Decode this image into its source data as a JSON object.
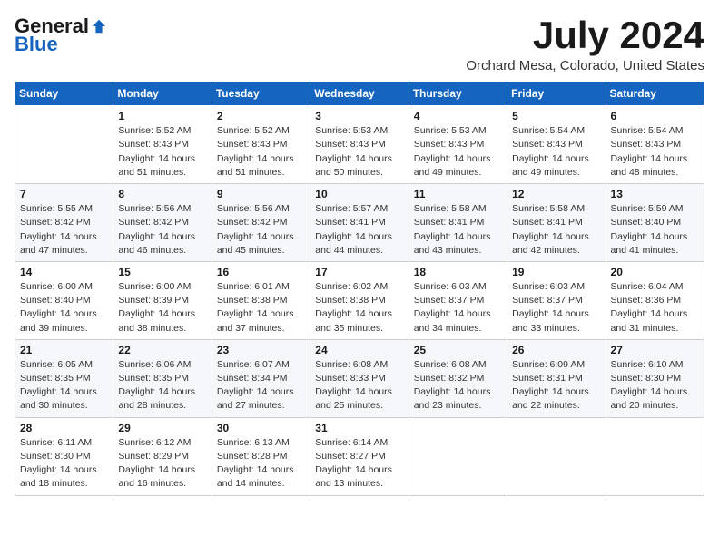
{
  "logo": {
    "general": "General",
    "blue": "Blue"
  },
  "title": {
    "month": "July 2024",
    "location": "Orchard Mesa, Colorado, United States"
  },
  "headers": [
    "Sunday",
    "Monday",
    "Tuesday",
    "Wednesday",
    "Thursday",
    "Friday",
    "Saturday"
  ],
  "weeks": [
    [
      {
        "day": "",
        "info": ""
      },
      {
        "day": "1",
        "info": "Sunrise: 5:52 AM\nSunset: 8:43 PM\nDaylight: 14 hours\nand 51 minutes."
      },
      {
        "day": "2",
        "info": "Sunrise: 5:52 AM\nSunset: 8:43 PM\nDaylight: 14 hours\nand 51 minutes."
      },
      {
        "day": "3",
        "info": "Sunrise: 5:53 AM\nSunset: 8:43 PM\nDaylight: 14 hours\nand 50 minutes."
      },
      {
        "day": "4",
        "info": "Sunrise: 5:53 AM\nSunset: 8:43 PM\nDaylight: 14 hours\nand 49 minutes."
      },
      {
        "day": "5",
        "info": "Sunrise: 5:54 AM\nSunset: 8:43 PM\nDaylight: 14 hours\nand 49 minutes."
      },
      {
        "day": "6",
        "info": "Sunrise: 5:54 AM\nSunset: 8:43 PM\nDaylight: 14 hours\nand 48 minutes."
      }
    ],
    [
      {
        "day": "7",
        "info": "Sunrise: 5:55 AM\nSunset: 8:42 PM\nDaylight: 14 hours\nand 47 minutes."
      },
      {
        "day": "8",
        "info": "Sunrise: 5:56 AM\nSunset: 8:42 PM\nDaylight: 14 hours\nand 46 minutes."
      },
      {
        "day": "9",
        "info": "Sunrise: 5:56 AM\nSunset: 8:42 PM\nDaylight: 14 hours\nand 45 minutes."
      },
      {
        "day": "10",
        "info": "Sunrise: 5:57 AM\nSunset: 8:41 PM\nDaylight: 14 hours\nand 44 minutes."
      },
      {
        "day": "11",
        "info": "Sunrise: 5:58 AM\nSunset: 8:41 PM\nDaylight: 14 hours\nand 43 minutes."
      },
      {
        "day": "12",
        "info": "Sunrise: 5:58 AM\nSunset: 8:41 PM\nDaylight: 14 hours\nand 42 minutes."
      },
      {
        "day": "13",
        "info": "Sunrise: 5:59 AM\nSunset: 8:40 PM\nDaylight: 14 hours\nand 41 minutes."
      }
    ],
    [
      {
        "day": "14",
        "info": "Sunrise: 6:00 AM\nSunset: 8:40 PM\nDaylight: 14 hours\nand 39 minutes."
      },
      {
        "day": "15",
        "info": "Sunrise: 6:00 AM\nSunset: 8:39 PM\nDaylight: 14 hours\nand 38 minutes."
      },
      {
        "day": "16",
        "info": "Sunrise: 6:01 AM\nSunset: 8:38 PM\nDaylight: 14 hours\nand 37 minutes."
      },
      {
        "day": "17",
        "info": "Sunrise: 6:02 AM\nSunset: 8:38 PM\nDaylight: 14 hours\nand 35 minutes."
      },
      {
        "day": "18",
        "info": "Sunrise: 6:03 AM\nSunset: 8:37 PM\nDaylight: 14 hours\nand 34 minutes."
      },
      {
        "day": "19",
        "info": "Sunrise: 6:03 AM\nSunset: 8:37 PM\nDaylight: 14 hours\nand 33 minutes."
      },
      {
        "day": "20",
        "info": "Sunrise: 6:04 AM\nSunset: 8:36 PM\nDaylight: 14 hours\nand 31 minutes."
      }
    ],
    [
      {
        "day": "21",
        "info": "Sunrise: 6:05 AM\nSunset: 8:35 PM\nDaylight: 14 hours\nand 30 minutes."
      },
      {
        "day": "22",
        "info": "Sunrise: 6:06 AM\nSunset: 8:35 PM\nDaylight: 14 hours\nand 28 minutes."
      },
      {
        "day": "23",
        "info": "Sunrise: 6:07 AM\nSunset: 8:34 PM\nDaylight: 14 hours\nand 27 minutes."
      },
      {
        "day": "24",
        "info": "Sunrise: 6:08 AM\nSunset: 8:33 PM\nDaylight: 14 hours\nand 25 minutes."
      },
      {
        "day": "25",
        "info": "Sunrise: 6:08 AM\nSunset: 8:32 PM\nDaylight: 14 hours\nand 23 minutes."
      },
      {
        "day": "26",
        "info": "Sunrise: 6:09 AM\nSunset: 8:31 PM\nDaylight: 14 hours\nand 22 minutes."
      },
      {
        "day": "27",
        "info": "Sunrise: 6:10 AM\nSunset: 8:30 PM\nDaylight: 14 hours\nand 20 minutes."
      }
    ],
    [
      {
        "day": "28",
        "info": "Sunrise: 6:11 AM\nSunset: 8:30 PM\nDaylight: 14 hours\nand 18 minutes."
      },
      {
        "day": "29",
        "info": "Sunrise: 6:12 AM\nSunset: 8:29 PM\nDaylight: 14 hours\nand 16 minutes."
      },
      {
        "day": "30",
        "info": "Sunrise: 6:13 AM\nSunset: 8:28 PM\nDaylight: 14 hours\nand 14 minutes."
      },
      {
        "day": "31",
        "info": "Sunrise: 6:14 AM\nSunset: 8:27 PM\nDaylight: 14 hours\nand 13 minutes."
      },
      {
        "day": "",
        "info": ""
      },
      {
        "day": "",
        "info": ""
      },
      {
        "day": "",
        "info": ""
      }
    ]
  ]
}
